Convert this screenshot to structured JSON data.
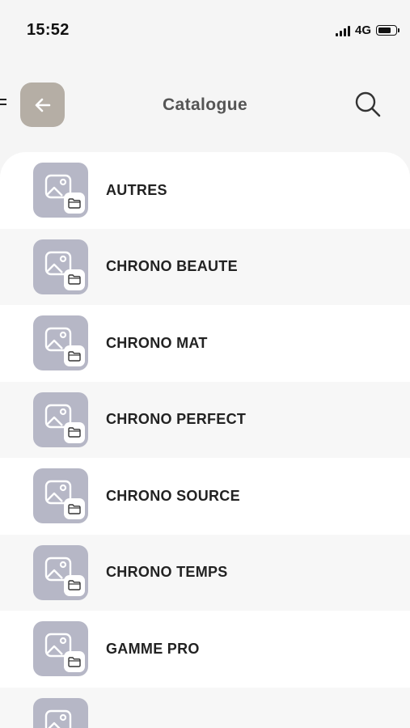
{
  "status_bar": {
    "time": "15:52",
    "network": "4G",
    "icons": [
      "signal-icon",
      "battery-icon"
    ]
  },
  "header": {
    "title": "Catalogue",
    "icons": [
      "back-arrow-icon",
      "search-icon",
      "menu-icon"
    ]
  },
  "colors": {
    "back_button": "#b5aea5",
    "thumb_background": "#b6b7c6",
    "alt_row": "#f7f7f7",
    "page_background": "#f5f5f5"
  },
  "categories": [
    {
      "label": "AUTRES"
    },
    {
      "label": "CHRONO BEAUTE"
    },
    {
      "label": "CHRONO MAT"
    },
    {
      "label": "CHRONO PERFECT"
    },
    {
      "label": "CHRONO SOURCE"
    },
    {
      "label": "CHRONO TEMPS"
    },
    {
      "label": "GAMME PRO"
    },
    {
      "label": ""
    }
  ]
}
